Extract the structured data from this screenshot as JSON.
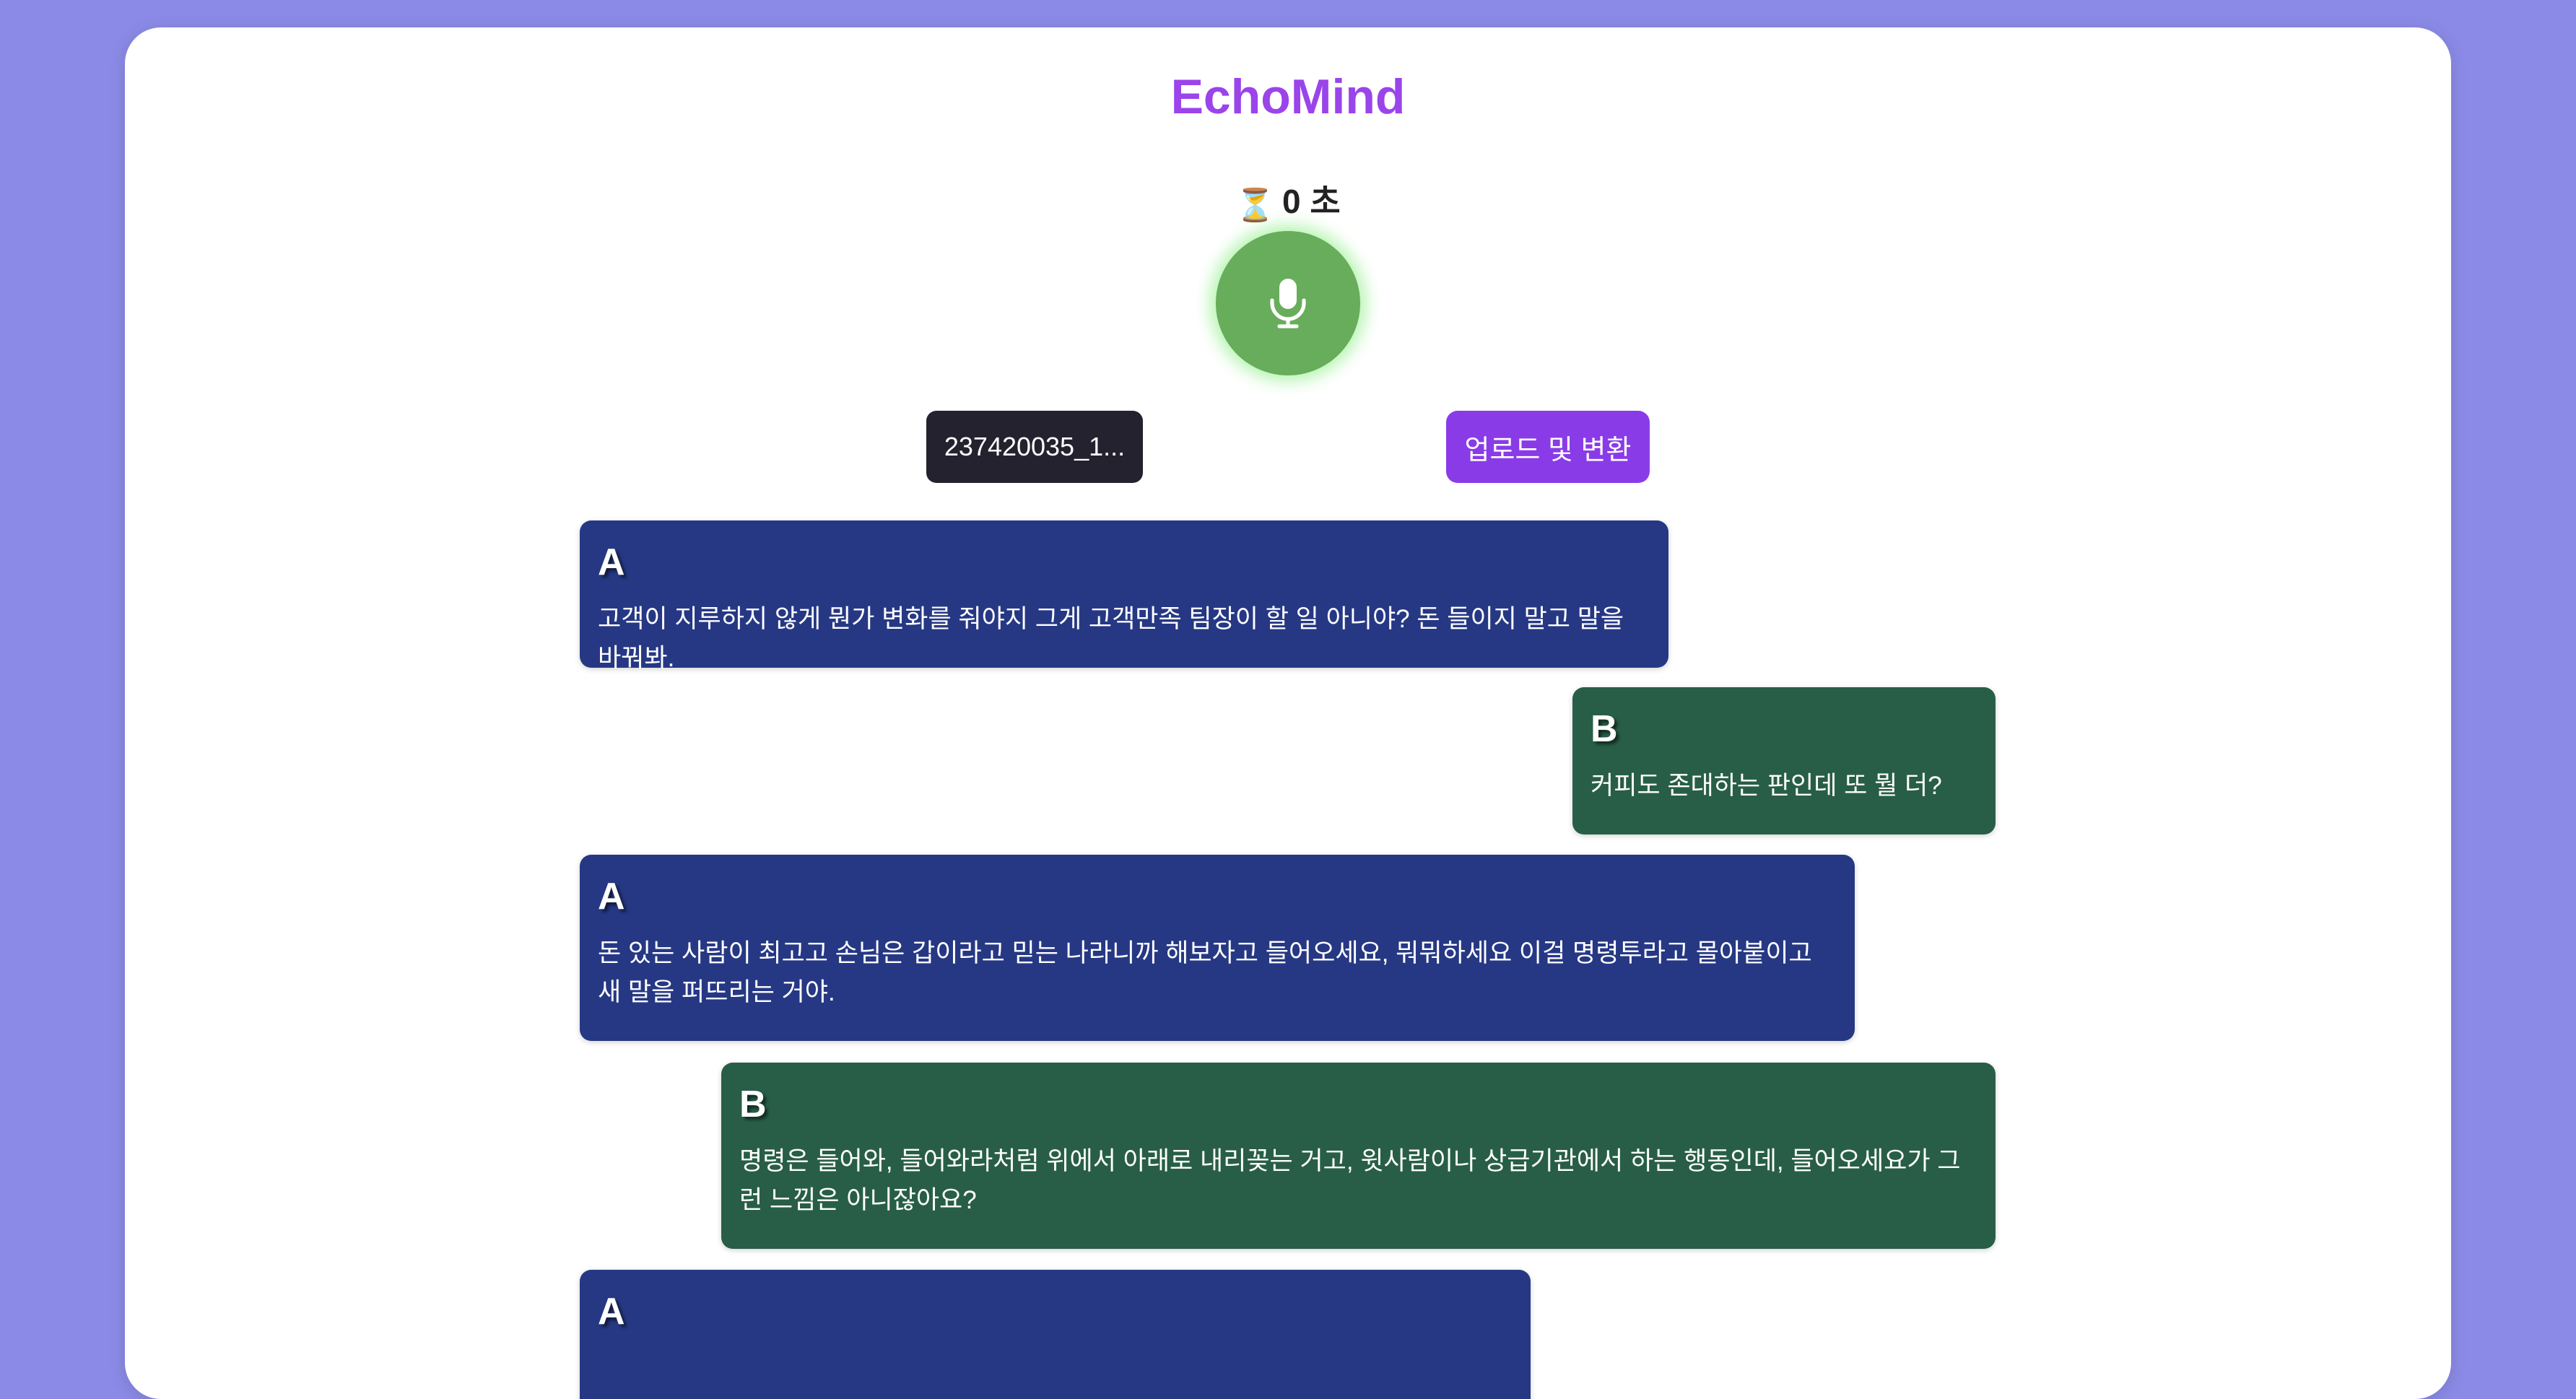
{
  "app": {
    "title": "EchoMind"
  },
  "timer": {
    "icon": "hourglass-icon",
    "glyph": "⏳",
    "value": "0 초"
  },
  "controls": {
    "mic_icon": "microphone-icon",
    "file_label": "237420035_1...",
    "upload_label": "업로드 및 변환"
  },
  "colors": {
    "title": "#9a44ea",
    "speaker_a": "#263884",
    "speaker_b": "#285e47",
    "mic": "#67ad5b",
    "upload": "#8a3be8",
    "background": "#8b8ae6"
  },
  "messages": [
    {
      "speaker": "A",
      "text": "고객이 지루하지 않게 뭔가 변화를 줘야지 그게 고객만족 팀장이 할 일 아니야? 돈 들이지 말고 말을 바꿔봐."
    },
    {
      "speaker": "B",
      "text": "커피도 존대하는 판인데 또 뭘 더?"
    },
    {
      "speaker": "A",
      "text": "돈 있는 사람이 최고고 손님은 갑이라고 믿는 나라니까 해보자고 들어오세요, 뭐뭐하세요 이걸 명령투라고 몰아붙이고 새 말을 퍼뜨리는 거야."
    },
    {
      "speaker": "B",
      "text": "명령은 들어와, 들어와라처럼 위에서 아래로 내리꽂는 거고, 윗사람이나 상급기관에서 하는 행동인데, 들어오세요가 그런 느낌은 아니잖아요?"
    },
    {
      "speaker": "A",
      "text": ""
    }
  ]
}
